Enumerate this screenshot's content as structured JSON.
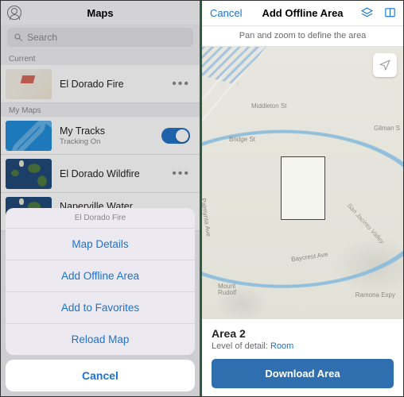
{
  "left": {
    "header_title": "Maps",
    "search_placeholder": "Search",
    "sections": {
      "current_label": "Current",
      "mymaps_label": "My Maps"
    },
    "current": [
      {
        "title": "El Dorado Fire"
      }
    ],
    "mymaps": [
      {
        "title": "My Tracks",
        "subtitle": "Tracking On",
        "toggle": true
      },
      {
        "title": "El Dorado Wildfire"
      },
      {
        "title": "Naperville Water Inspection"
      }
    ],
    "sheet": {
      "title": "El Dorado Fire",
      "items": [
        "Map Details",
        "Add Offline Area",
        "Add to Favorites",
        "Reload Map"
      ],
      "cancel": "Cancel"
    }
  },
  "right": {
    "cancel": "Cancel",
    "title": "Add Offline Area",
    "hint": "Pan and zoom to define the area",
    "streets": {
      "middleton": "Middleton St",
      "bridge": "Bridge St",
      "gilman": "Gilman S",
      "palmyrita": "Palmyrita Ave",
      "baycrest": "Baycrest Ave",
      "rudolf": "Mount Rudolf",
      "sanjacinto": "San Jacinto Valley",
      "ramona": "Ramona Expy"
    },
    "card": {
      "area_name": "Area 2",
      "lod_label": "Level of detail: ",
      "lod_value": "Room",
      "download": "Download Area"
    }
  }
}
